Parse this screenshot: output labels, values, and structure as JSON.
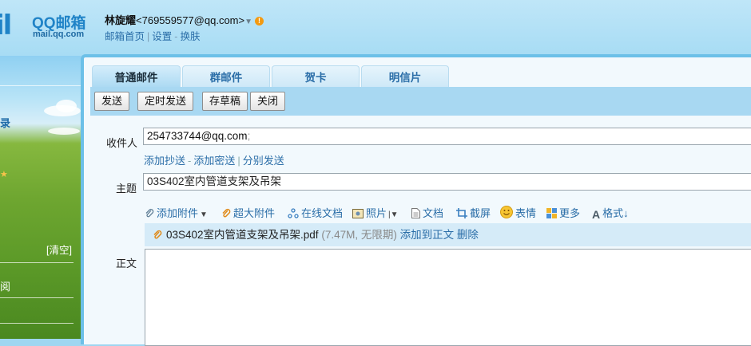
{
  "brand": {
    "logo_mark": "il",
    "title": "QQ邮箱",
    "domain": "mail.qq.com"
  },
  "user": {
    "name": "林旋耀",
    "email": "<769559577@qq.com>",
    "arrow": "▼",
    "warn": "!"
  },
  "top_links": {
    "home": "邮箱首页",
    "sep": "|",
    "settings": "设置",
    "dash": "-",
    "skin": "换肤"
  },
  "sidebar": {
    "item_record": "录",
    "clear": "[清空]",
    "item_read": "阅",
    "star": "★"
  },
  "tabs": [
    "普通邮件",
    "群邮件",
    "贺卡",
    "明信片"
  ],
  "toolbar": {
    "send": "发送",
    "timed_send": "定时发送",
    "save_draft": "存草稿",
    "close": "关闭"
  },
  "compose": {
    "to_label": "收件人",
    "to_value": "254733744@qq.com",
    "to_sep": ";",
    "cc_link": "添加抄送",
    "bcc_link": "添加密送",
    "split_link": "分别发送",
    "dash": "-",
    "bar": "|",
    "subject_label": "主题",
    "subject_value": "03S402室内管道支架及吊架",
    "body_label": "正文"
  },
  "tools": {
    "add_attachment": "添加附件",
    "large_attachment": "超大附件",
    "online_doc": "在线文档",
    "photo": "照片",
    "document": "文档",
    "screenshot": "截屏",
    "emoji": "表情",
    "more": "更多",
    "format": "格式↓"
  },
  "attachment": {
    "filename": "03S402室内管道支架及吊架.pdf",
    "meta": "(7.47M, 无限期)",
    "add_to_body": "添加到正文",
    "delete": "删除"
  },
  "colors": {
    "accent": "#2b6ea8",
    "panel_border": "#6cc0e8",
    "tab_active": "#a8d8f2"
  }
}
